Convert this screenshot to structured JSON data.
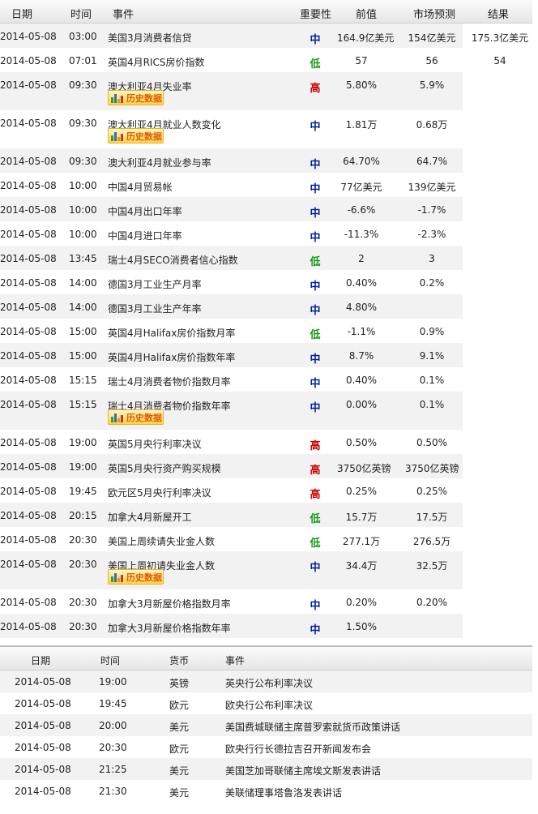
{
  "calendar": {
    "headers": {
      "date": "日期",
      "time": "时间",
      "event": "事件",
      "importance": "重要性",
      "previous": "前值",
      "forecast": "市场预测",
      "result": "结果"
    },
    "history_label": "历史数据",
    "rows": [
      {
        "date": "2014-05-08",
        "time": "03:00",
        "event": "美国3月消费者信贷",
        "importance": "中",
        "level": "mid",
        "previous": "164.9亿美元",
        "forecast": "154亿美元",
        "result": "175.3亿美元",
        "history": false
      },
      {
        "date": "2014-05-08",
        "time": "07:01",
        "event": "英国4月RICS房价指数",
        "importance": "低",
        "level": "low",
        "previous": "57",
        "forecast": "56",
        "result": "54",
        "history": false
      },
      {
        "date": "2014-05-08",
        "time": "09:30",
        "event": "澳大利亚4月失业率",
        "importance": "高",
        "level": "high",
        "previous": "5.80%",
        "forecast": "5.9%",
        "result": "",
        "history": true
      },
      {
        "date": "2014-05-08",
        "time": "09:30",
        "event": "澳大利亚4月就业人数变化",
        "importance": "中",
        "level": "mid",
        "previous": "1.81万",
        "forecast": "0.68万",
        "result": "",
        "history": true
      },
      {
        "date": "2014-05-08",
        "time": "09:30",
        "event": "澳大利亚4月就业参与率",
        "importance": "中",
        "level": "mid",
        "previous": "64.70%",
        "forecast": "64.7%",
        "result": "",
        "history": false
      },
      {
        "date": "2014-05-08",
        "time": "10:00",
        "event": "中国4月贸易帐",
        "importance": "中",
        "level": "mid",
        "previous": "77亿美元",
        "forecast": "139亿美元",
        "result": "",
        "history": false
      },
      {
        "date": "2014-05-08",
        "time": "10:00",
        "event": "中国4月出口年率",
        "importance": "中",
        "level": "mid",
        "previous": "-6.6%",
        "forecast": "-1.7%",
        "result": "",
        "history": false
      },
      {
        "date": "2014-05-08",
        "time": "10:00",
        "event": "中国4月进口年率",
        "importance": "中",
        "level": "mid",
        "previous": "-11.3%",
        "forecast": "-2.3%",
        "result": "",
        "history": false
      },
      {
        "date": "2014-05-08",
        "time": "13:45",
        "event": "瑞士4月SECO消费者信心指数",
        "importance": "低",
        "level": "low",
        "previous": "2",
        "forecast": "3",
        "result": "",
        "history": false
      },
      {
        "date": "2014-05-08",
        "time": "14:00",
        "event": "德国3月工业生产月率",
        "importance": "中",
        "level": "mid",
        "previous": "0.40%",
        "forecast": "0.2%",
        "result": "",
        "history": false
      },
      {
        "date": "2014-05-08",
        "time": "14:00",
        "event": "德国3月工业生产年率",
        "importance": "中",
        "level": "mid",
        "previous": "4.80%",
        "forecast": "",
        "result": "",
        "history": false
      },
      {
        "date": "2014-05-08",
        "time": "15:00",
        "event": "英国4月Halifax房价指数月率",
        "importance": "低",
        "level": "low",
        "previous": "-1.1%",
        "forecast": "0.9%",
        "result": "",
        "history": false
      },
      {
        "date": "2014-05-08",
        "time": "15:00",
        "event": "英国4月Halifax房价指数年率",
        "importance": "中",
        "level": "mid",
        "previous": "8.7%",
        "forecast": "9.1%",
        "result": "",
        "history": false
      },
      {
        "date": "2014-05-08",
        "time": "15:15",
        "event": "瑞士4月消费者物价指数月率",
        "importance": "中",
        "level": "mid",
        "previous": "0.40%",
        "forecast": "0.1%",
        "result": "",
        "history": false
      },
      {
        "date": "2014-05-08",
        "time": "15:15",
        "event": "瑞士4月消费者物价指数年率",
        "importance": "中",
        "level": "mid",
        "previous": "0.00%",
        "forecast": "0.1%",
        "result": "",
        "history": true
      },
      {
        "date": "2014-05-08",
        "time": "19:00",
        "event": "英国5月央行利率决议",
        "importance": "高",
        "level": "high",
        "previous": "0.50%",
        "forecast": "0.50%",
        "result": "",
        "history": false
      },
      {
        "date": "2014-05-08",
        "time": "19:00",
        "event": "英国5月央行资产购买规模",
        "importance": "高",
        "level": "high",
        "previous": "3750亿英镑",
        "forecast": "3750亿英镑",
        "result": "",
        "history": false
      },
      {
        "date": "2014-05-08",
        "time": "19:45",
        "event": "欧元区5月央行利率决议",
        "importance": "高",
        "level": "high",
        "previous": "0.25%",
        "forecast": "0.25%",
        "result": "",
        "history": false
      },
      {
        "date": "2014-05-08",
        "time": "20:15",
        "event": "加拿大4月新屋开工",
        "importance": "低",
        "level": "low",
        "previous": "15.7万",
        "forecast": "17.5万",
        "result": "",
        "history": false
      },
      {
        "date": "2014-05-08",
        "time": "20:30",
        "event": "美国上周续请失业金人数",
        "importance": "低",
        "level": "low",
        "previous": "277.1万",
        "forecast": "276.5万",
        "result": "",
        "history": false
      },
      {
        "date": "2014-05-08",
        "time": "20:30",
        "event": "美国上周初请失业金人数",
        "importance": "中",
        "level": "mid",
        "previous": "34.4万",
        "forecast": "32.5万",
        "result": "",
        "history": true
      },
      {
        "date": "2014-05-08",
        "time": "20:30",
        "event": "加拿大3月新屋价格指数月率",
        "importance": "中",
        "level": "mid",
        "previous": "0.20%",
        "forecast": "0.20%",
        "result": "",
        "history": false
      },
      {
        "date": "2014-05-08",
        "time": "20:30",
        "event": "加拿大3月新屋价格指数年率",
        "importance": "中",
        "level": "mid",
        "previous": "1.50%",
        "forecast": "",
        "result": "",
        "history": false
      }
    ]
  },
  "events": {
    "headers": {
      "date": "日期",
      "time": "时间",
      "currency": "货币",
      "event": "事件"
    },
    "rows": [
      {
        "date": "2014-05-08",
        "time": "19:00",
        "currency": "英镑",
        "event": "英央行公布利率决议"
      },
      {
        "date": "2014-05-08",
        "time": "19:45",
        "currency": "欧元",
        "event": "欧央行公布利率决议"
      },
      {
        "date": "2014-05-08",
        "time": "20:00",
        "currency": "美元",
        "event": "美国费城联储主席普罗索就货币政策讲话"
      },
      {
        "date": "2014-05-08",
        "time": "20:30",
        "currency": "欧元",
        "event": "欧央行行长德拉吉召开新闻发布会"
      },
      {
        "date": "2014-05-08",
        "time": "21:25",
        "currency": "美元",
        "event": "美国芝加哥联储主席埃文斯发表讲话"
      },
      {
        "date": "2014-05-08",
        "time": "21:30",
        "currency": "美元",
        "event": "美联储理事塔鲁洛发表讲话"
      }
    ]
  },
  "colors": {
    "high": "#cc0000",
    "mid": "#001f99",
    "low": "#139913",
    "row_alt": "#f2f2f2",
    "history_text": "#e05a00"
  },
  "icons": {
    "history": "bar-chart-icon"
  }
}
